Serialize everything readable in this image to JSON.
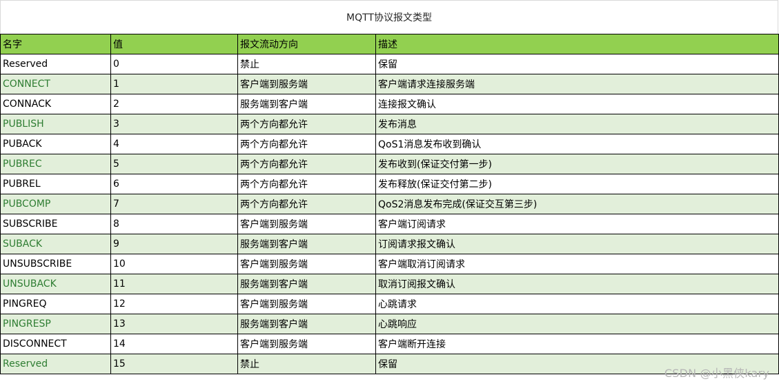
{
  "title": "MQTT协议报文类型",
  "columns": [
    "名字",
    "值",
    "报文流动方向",
    "描述"
  ],
  "rows": [
    {
      "name": "Reserved",
      "value": "0",
      "direction": "禁止",
      "desc": "保留"
    },
    {
      "name": "CONNECT",
      "value": "1",
      "direction": "客户端到服务端",
      "desc": "客户端请求连接服务端"
    },
    {
      "name": "CONNACK",
      "value": "2",
      "direction": "服务端到客户端",
      "desc": "连接报文确认"
    },
    {
      "name": "PUBLISH",
      "value": "3",
      "direction": "两个方向都允许",
      "desc": "发布消息"
    },
    {
      "name": "PUBACK",
      "value": "4",
      "direction": "两个方向都允许",
      "desc": "QoS1消息发布收到确认"
    },
    {
      "name": "PUBREC",
      "value": "5",
      "direction": "两个方向都允许",
      "desc": "发布收到(保证交付第一步)"
    },
    {
      "name": "PUBREL",
      "value": "6",
      "direction": "两个方向都允许",
      "desc": "发布释放(保证交付第二步)"
    },
    {
      "name": "PUBCOMP",
      "value": "7",
      "direction": "两个方向都允许",
      "desc": "QoS2消息发布完成(保证交互第三步)"
    },
    {
      "name": "SUBSCRIBE",
      "value": "8",
      "direction": "客户端到服务端",
      "desc": "客户端订阅请求"
    },
    {
      "name": "SUBACK",
      "value": "9",
      "direction": "服务端到客户端",
      "desc": "订阅请求报文确认"
    },
    {
      "name": "UNSUBSCRIBE",
      "value": "10",
      "direction": "客户端到服务端",
      "desc": "客户端取消订阅请求"
    },
    {
      "name": "UNSUBACK",
      "value": "11",
      "direction": "服务端到客户端",
      "desc": "取消订阅报文确认"
    },
    {
      "name": "PINGREQ",
      "value": "12",
      "direction": "客户端到服务端",
      "desc": "心跳请求"
    },
    {
      "name": "PINGRESP",
      "value": "13",
      "direction": "服务端到客户端",
      "desc": "心跳响应"
    },
    {
      "name": "DISCONNECT",
      "value": "14",
      "direction": "客户端到服务端",
      "desc": "客户端断开连接"
    },
    {
      "name": "Reserved",
      "value": "15",
      "direction": "禁止",
      "desc": "保留"
    }
  ],
  "watermark": "CSDN @小黑侠kary",
  "colors": {
    "header_bg": "#92d050",
    "band_bg": "#e2efda",
    "band_name_text": "#2e7d32",
    "border": "#000000"
  }
}
